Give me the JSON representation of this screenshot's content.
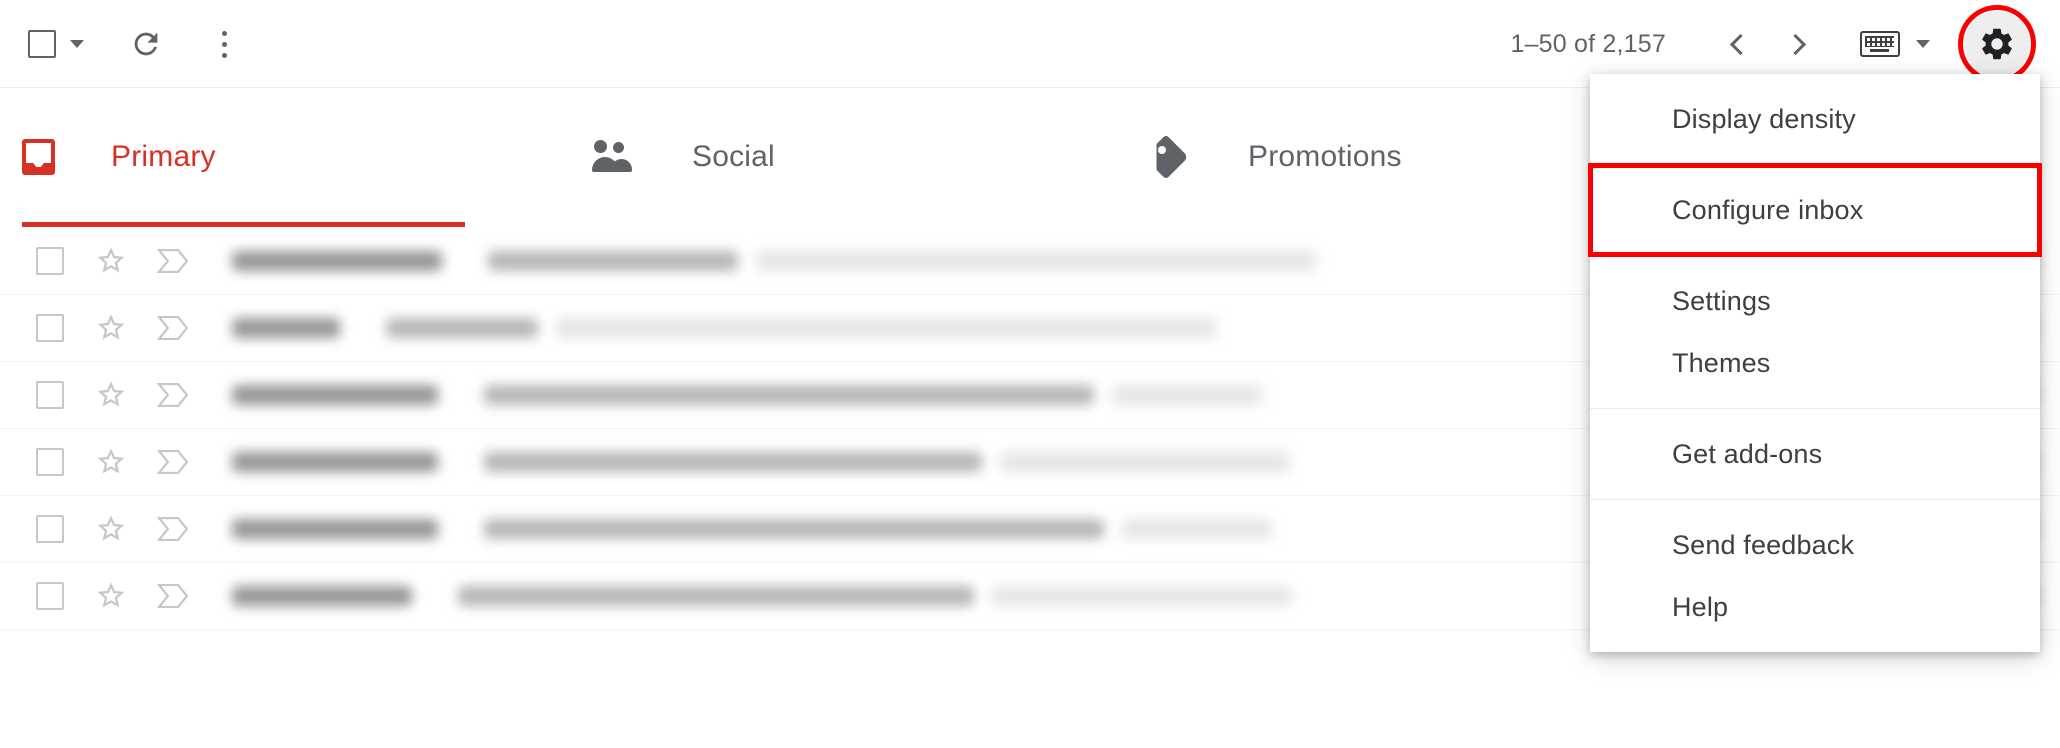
{
  "toolbar": {
    "select_all": {
      "name": "Select",
      "icon": "checkbox-icon"
    },
    "select_all_caret": "▾",
    "refresh": {
      "label": "Refresh",
      "icon": "refresh-icon"
    },
    "more_options": {
      "label": "More",
      "icon": "more-vert-icon"
    },
    "pagination": {
      "count_text": "1–50 of 2,157",
      "range_start": 1,
      "range_end": 50,
      "total": "2,157",
      "prev_label": "Older",
      "next_label": "Newer"
    },
    "input_tools": {
      "label": "Input tools",
      "icon": "keyboard-icon"
    },
    "settings": {
      "label": "Settings",
      "icon": "gear-icon",
      "highlighted": true
    }
  },
  "annotations": {
    "ring_color": "#fa0000",
    "rect_color": "#fa0000",
    "targets": [
      "settings-gear-button",
      "menu-item-configure-inbox"
    ]
  },
  "tabs": {
    "active_index": 0,
    "active_color": "#d93025",
    "inactive_color": "#5f6368",
    "items": [
      {
        "label": "Primary",
        "icon": "inbox-icon",
        "active": true
      },
      {
        "label": "Social",
        "icon": "people-icon",
        "active": false
      },
      {
        "label": "Promotions",
        "icon": "tag-icon",
        "active": false
      }
    ]
  },
  "settings_menu": {
    "visible": true,
    "groups": [
      {
        "items": [
          {
            "label": "Display density",
            "highlighted": false
          }
        ]
      },
      {
        "items": [
          {
            "label": "Configure inbox",
            "highlighted": true
          }
        ]
      },
      {
        "items": [
          {
            "label": "Settings",
            "highlighted": false
          },
          {
            "label": "Themes",
            "highlighted": false
          }
        ]
      },
      {
        "items": [
          {
            "label": "Get add-ons",
            "highlighted": false
          }
        ]
      },
      {
        "items": [
          {
            "label": "Send feedback",
            "highlighted": false
          },
          {
            "label": "Help",
            "highlighted": false
          }
        ]
      }
    ]
  },
  "email_list": {
    "redacted": true,
    "row_controls": {
      "checkbox": "checkbox-icon",
      "star": "star-outline-icon",
      "importance": "importance-marker-icon"
    },
    "rows": [
      {
        "sender_w": 210,
        "subject_w": 250,
        "snippet_w": 560,
        "trail_w": 70
      },
      {
        "sender_w": 108,
        "subject_w": 152,
        "snippet_w": 660,
        "trail_w": 70
      },
      {
        "sender_w": 206,
        "subject_w": 610,
        "snippet_w": 150,
        "trail_w": 70
      },
      {
        "sender_w": 206,
        "subject_w": 498,
        "snippet_w": 290,
        "trail_w": 70
      },
      {
        "sender_w": 206,
        "subject_w": 620,
        "snippet_w": 150,
        "trail_w": 70
      },
      {
        "sender_w": 180,
        "subject_w": 516,
        "snippet_w": 300,
        "trail_w": 70
      }
    ]
  }
}
